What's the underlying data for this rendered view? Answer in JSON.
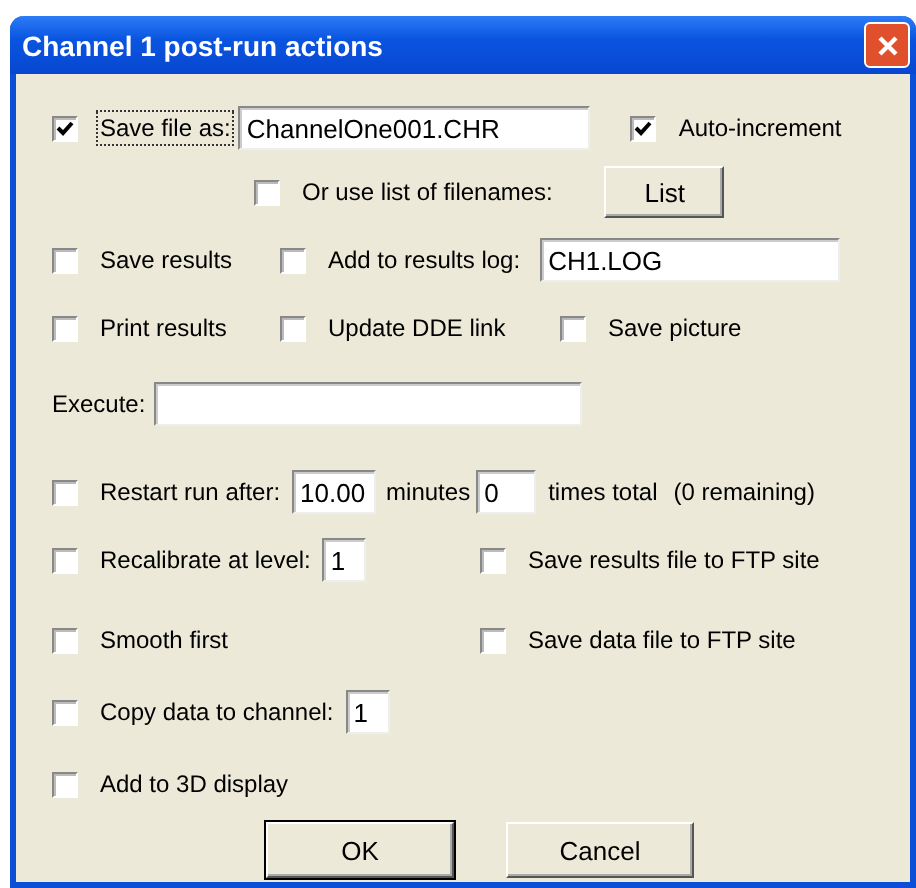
{
  "window": {
    "title": "Channel 1 post-run actions"
  },
  "save_file": {
    "label": "Save file as:",
    "checked": true,
    "focused": true,
    "value": "ChannelOne001.CHR"
  },
  "auto_increment": {
    "label": "Auto-increment",
    "checked": true
  },
  "use_list": {
    "label": "Or use list of filenames:",
    "checked": false
  },
  "list_button": "List",
  "save_results": {
    "label": "Save results",
    "checked": false
  },
  "results_log": {
    "label": "Add to results log:",
    "checked": false,
    "value": "CH1.LOG"
  },
  "print_results": {
    "label": "Print results",
    "checked": false
  },
  "update_dde": {
    "label": "Update DDE link",
    "checked": false
  },
  "save_picture": {
    "label": "Save picture",
    "checked": false
  },
  "execute": {
    "label": "Execute:"
  },
  "restart": {
    "label": "Restart run after:",
    "checked": false,
    "minutes_value": "10.00",
    "minutes_label": "minutes",
    "times_value": "0",
    "times_label": "times total",
    "remaining": "(0 remaining)"
  },
  "recalibrate": {
    "label": "Recalibrate at level:",
    "checked": false,
    "value": "1"
  },
  "ftp_results": {
    "label": "Save results file to FTP site",
    "checked": false
  },
  "smooth": {
    "label": "Smooth first",
    "checked": false
  },
  "ftp_data": {
    "label": "Save data file to FTP site",
    "checked": false
  },
  "copy": {
    "label": "Copy data to channel:",
    "checked": false,
    "value": "1"
  },
  "add_3d": {
    "label": "Add to 3D display",
    "checked": false
  },
  "buttons": [
    {
      "label": "OK",
      "kind": "default"
    },
    {
      "label": "Cancel",
      "kind": "normal"
    }
  ]
}
